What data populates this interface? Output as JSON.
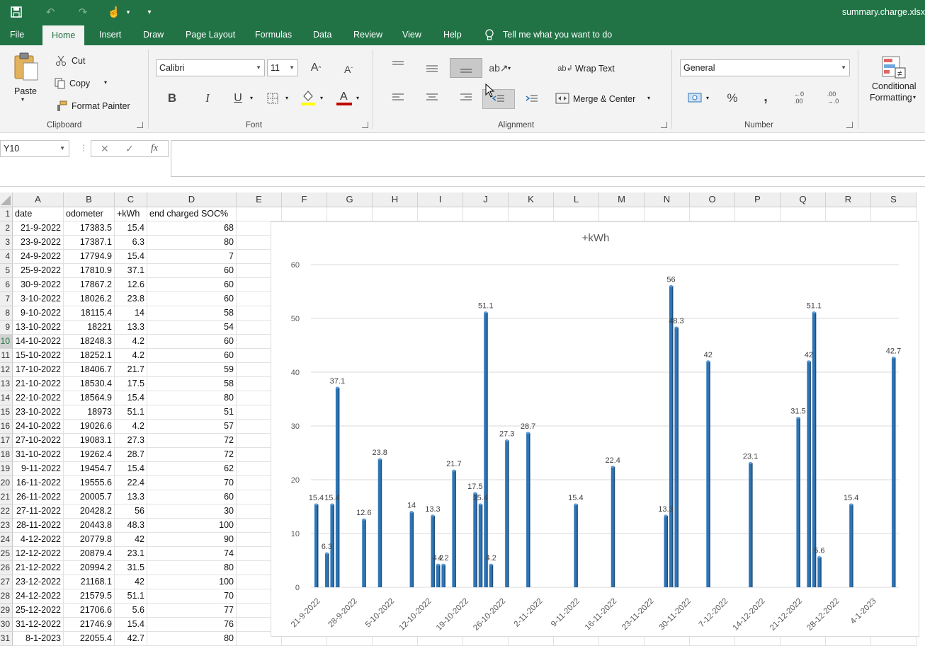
{
  "app": {
    "file_name": "summary.charge.xlsx",
    "qat_customize": "▾"
  },
  "menu": {
    "tabs": [
      "File",
      "Home",
      "Insert",
      "Draw",
      "Page Layout",
      "Formulas",
      "Data",
      "Review",
      "View",
      "Help"
    ],
    "active_tab": "Home",
    "tell_me": "Tell me what you want to do"
  },
  "ribbon": {
    "clipboard": {
      "label": "Clipboard",
      "paste": "Paste",
      "cut": "Cut",
      "copy": "Copy",
      "format_painter": "Format Painter"
    },
    "font": {
      "label": "Font",
      "font_name": "Calibri",
      "font_size": "11",
      "bold": "B",
      "italic": "I",
      "underline": "U",
      "font_color": "#c00000",
      "highlight_color": "#ffff00"
    },
    "alignment": {
      "label": "Alignment",
      "wrap_text": "Wrap Text",
      "merge_center": "Merge & Center"
    },
    "number": {
      "label": "Number",
      "format": "General",
      "percent": "%",
      "comma": ","
    },
    "styles": {
      "conditional_formatting_line1": "Conditional",
      "conditional_formatting_line2": "Formatting"
    }
  },
  "formula_bar": {
    "name_box": "Y10",
    "formula": "",
    "cancel": "✕",
    "enter": "✓",
    "fx": "fx"
  },
  "grid": {
    "columns": [
      "A",
      "B",
      "C",
      "D",
      "E",
      "F",
      "G",
      "H",
      "I",
      "J",
      "K",
      "L",
      "M",
      "N",
      "O",
      "P",
      "Q",
      "R",
      "S"
    ],
    "rows": [
      "1",
      "2",
      "3",
      "4",
      "5",
      "6",
      "7",
      "8",
      "9",
      "10",
      "11",
      "12",
      "13",
      "14",
      "15",
      "16",
      "17",
      "18",
      "19",
      "20",
      "21",
      "22",
      "23",
      "24",
      "25",
      "26",
      "27",
      "28",
      "29",
      "30",
      "31"
    ],
    "selected_row": "10",
    "headers": [
      "date",
      "odometer",
      "+kWh",
      "end charged SOC%"
    ],
    "data": [
      [
        "21-9-2022",
        "17383.5",
        "15.4",
        "68"
      ],
      [
        "23-9-2022",
        "17387.1",
        "6.3",
        "80"
      ],
      [
        "24-9-2022",
        "17794.9",
        "15.4",
        "7"
      ],
      [
        "25-9-2022",
        "17810.9",
        "37.1",
        "60"
      ],
      [
        "30-9-2022",
        "17867.2",
        "12.6",
        "60"
      ],
      [
        "3-10-2022",
        "18026.2",
        "23.8",
        "60"
      ],
      [
        "9-10-2022",
        "18115.4",
        "14",
        "58"
      ],
      [
        "13-10-2022",
        "18221",
        "13.3",
        "54"
      ],
      [
        "14-10-2022",
        "18248.3",
        "4.2",
        "60"
      ],
      [
        "15-10-2022",
        "18252.1",
        "4.2",
        "60"
      ],
      [
        "17-10-2022",
        "18406.7",
        "21.7",
        "59"
      ],
      [
        "21-10-2022",
        "18530.4",
        "17.5",
        "58"
      ],
      [
        "22-10-2022",
        "18564.9",
        "15.4",
        "80"
      ],
      [
        "23-10-2022",
        "18973",
        "51.1",
        "51"
      ],
      [
        "24-10-2022",
        "19026.6",
        "4.2",
        "57"
      ],
      [
        "27-10-2022",
        "19083.1",
        "27.3",
        "72"
      ],
      [
        "31-10-2022",
        "19262.4",
        "28.7",
        "72"
      ],
      [
        "9-11-2022",
        "19454.7",
        "15.4",
        "62"
      ],
      [
        "16-11-2022",
        "19555.6",
        "22.4",
        "70"
      ],
      [
        "26-11-2022",
        "20005.7",
        "13.3",
        "60"
      ],
      [
        "27-11-2022",
        "20428.2",
        "56",
        "30"
      ],
      [
        "28-11-2022",
        "20443.8",
        "48.3",
        "100"
      ],
      [
        "4-12-2022",
        "20779.8",
        "42",
        "90"
      ],
      [
        "12-12-2022",
        "20879.4",
        "23.1",
        "74"
      ],
      [
        "21-12-2022",
        "20994.2",
        "31.5",
        "80"
      ],
      [
        "23-12-2022",
        "21168.1",
        "42",
        "100"
      ],
      [
        "24-12-2022",
        "21579.5",
        "51.1",
        "70"
      ],
      [
        "25-12-2022",
        "21706.6",
        "5.6",
        "77"
      ],
      [
        "31-12-2022",
        "21746.9",
        "15.4",
        "76"
      ],
      [
        "8-1-2023",
        "22055.4",
        "42.7",
        "80"
      ]
    ]
  },
  "chart_data": {
    "type": "bar",
    "title": "+kWh",
    "bar_color": "#2e75b6",
    "ylim": [
      0,
      60
    ],
    "y_ticks": [
      "0",
      "10",
      "20",
      "30",
      "40",
      "50",
      "60"
    ],
    "x_date_axis": true,
    "x_ticks": [
      "21-9-2022",
      "28-9-2022",
      "5-10-2022",
      "12-10-2022",
      "19-10-2022",
      "26-10-2022",
      "2-11-2022",
      "9-11-2022",
      "16-11-2022",
      "23-11-2022",
      "30-11-2022",
      "7-12-2022",
      "14-12-2022",
      "21-12-2022",
      "28-12-2022",
      "4-1-2023"
    ],
    "x": [
      "2022-09-21",
      "2022-09-23",
      "2022-09-24",
      "2022-09-25",
      "2022-09-30",
      "2022-10-03",
      "2022-10-09",
      "2022-10-13",
      "2022-10-14",
      "2022-10-15",
      "2022-10-17",
      "2022-10-21",
      "2022-10-22",
      "2022-10-23",
      "2022-10-24",
      "2022-10-27",
      "2022-10-31",
      "2022-11-09",
      "2022-11-16",
      "2022-11-26",
      "2022-11-27",
      "2022-11-28",
      "2022-12-04",
      "2022-12-12",
      "2022-12-21",
      "2022-12-23",
      "2022-12-24",
      "2022-12-25",
      "2022-12-31",
      "2023-01-08"
    ],
    "values": [
      15.4,
      6.3,
      15.4,
      37.1,
      12.6,
      23.8,
      14,
      13.3,
      4.2,
      4.2,
      21.7,
      17.5,
      15.4,
      51.1,
      4.2,
      27.3,
      28.7,
      15.4,
      22.4,
      13.3,
      56,
      48.3,
      42,
      23.1,
      31.5,
      42,
      51.1,
      5.6,
      15.4,
      42.7
    ],
    "data_labels": true,
    "grid": true
  }
}
